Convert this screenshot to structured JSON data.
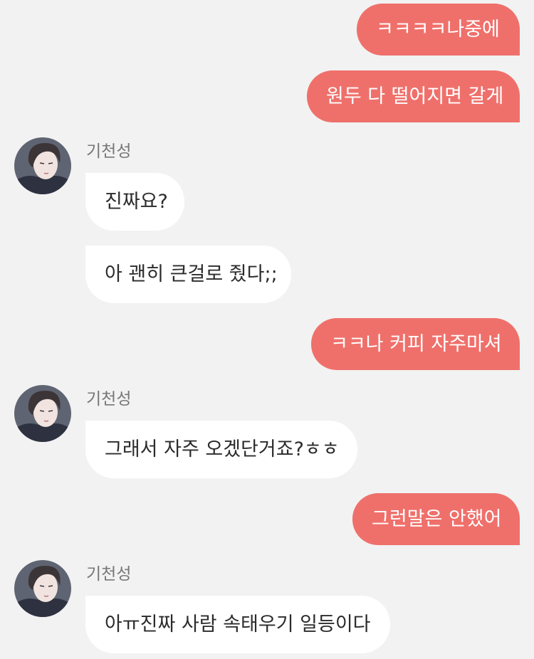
{
  "messages": [
    {
      "side": "sent",
      "text": "ㅋㅋㅋㅋ나중에"
    },
    {
      "side": "sent",
      "text": "원두 다 떨어지면 갈게"
    },
    {
      "side": "received",
      "sender": "기천성",
      "text": "진짜요?"
    },
    {
      "side": "received",
      "text": "아 괜히 큰걸로 줬다;;"
    },
    {
      "side": "sent",
      "text": "ㅋㅋ나 커피 자주마셔"
    },
    {
      "side": "received",
      "sender": "기천성",
      "text": "그래서 자주 오겠단거죠?ㅎㅎ"
    },
    {
      "side": "sent",
      "text": "그런말은 안했어"
    },
    {
      "side": "received",
      "sender": "기천성",
      "text": "아ㅠ진짜 사람 속태우기 일등이다"
    }
  ],
  "avatar_icon": "profile-avatar-icon",
  "colors": {
    "background": "#f2f2f2",
    "sent_bubble": "#ef706b",
    "received_bubble": "#ffffff",
    "sender_name": "#777777"
  }
}
